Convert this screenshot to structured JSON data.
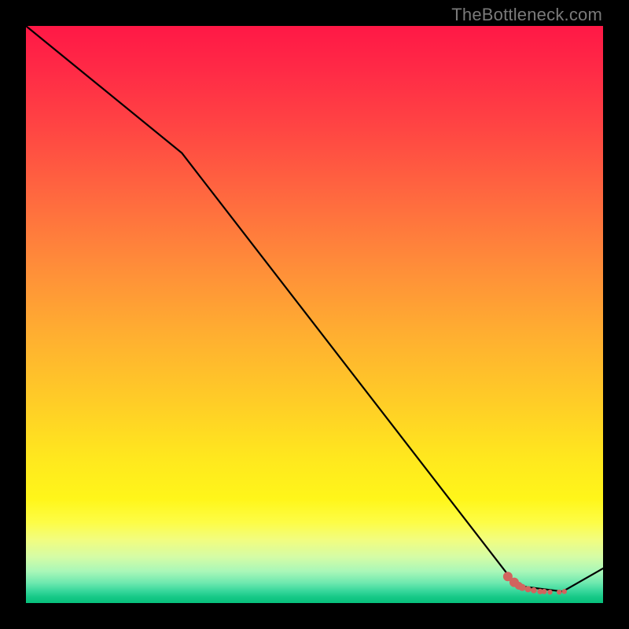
{
  "watermark": "TheBottleneck.com",
  "colors": {
    "curve_stroke": "#000000",
    "marker_fill": "#d1645e",
    "marker_fill_light": "#d47772"
  },
  "chart_data": {
    "type": "line",
    "title": "",
    "xlabel": "",
    "ylabel": "",
    "xlim": [
      0,
      100
    ],
    "ylim": [
      0,
      100
    ],
    "grid": false,
    "legend": false,
    "curve": [
      {
        "x": 0,
        "y": 100
      },
      {
        "x": 27,
        "y": 78
      },
      {
        "x": 85,
        "y": 3
      },
      {
        "x": 93,
        "y": 2
      },
      {
        "x": 100,
        "y": 6
      }
    ],
    "markers": [
      {
        "x": 83.5,
        "y": 4.6,
        "size": 6.0
      },
      {
        "x": 84.6,
        "y": 3.6,
        "size": 6.0
      },
      {
        "x": 85.4,
        "y": 3.0,
        "size": 5.0
      },
      {
        "x": 86.0,
        "y": 2.7,
        "size": 4.5
      },
      {
        "x": 87.0,
        "y": 2.4,
        "size": 4.0
      },
      {
        "x": 88.0,
        "y": 2.2,
        "size": 3.8
      },
      {
        "x": 89.1,
        "y": 2.0,
        "size": 3.6
      },
      {
        "x": 89.8,
        "y": 2.0,
        "size": 3.4
      },
      {
        "x": 90.8,
        "y": 1.9,
        "size": 3.2
      },
      {
        "x": 92.4,
        "y": 1.9,
        "size": 3.2
      },
      {
        "x": 93.3,
        "y": 2.0,
        "size": 3.2
      }
    ]
  }
}
